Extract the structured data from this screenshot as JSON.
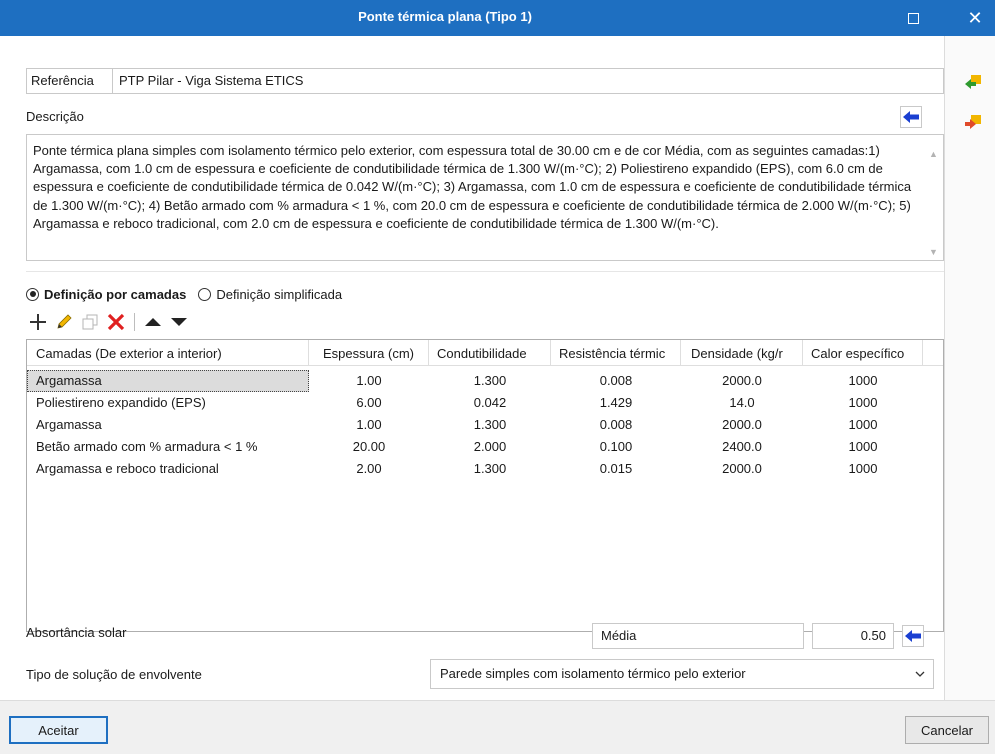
{
  "window": {
    "title": "Ponte térmica plana (Tipo 1)"
  },
  "referencia": {
    "label": "Referência",
    "value": "PTP Pilar - Viga Sistema ETICS"
  },
  "descricao": {
    "label": "Descrição",
    "text": "Ponte térmica plana simples com isolamento térmico pelo exterior, com espessura total de 30.00 cm e de cor Média, com as seguintes camadas:1) Argamassa, com 1.0 cm de espessura e coeficiente de condutibilidade térmica de 1.300 W/(m·°C); 2) Poliestireno expandido (EPS), com 6.0 cm de espessura e coeficiente de condutibilidade térmica de 0.042 W/(m·°C); 3) Argamassa, com 1.0 cm de espessura e coeficiente de condutibilidade térmica de 1.300 W/(m·°C); 4) Betão armado com % armadura < 1 %, com 20.0 cm de espessura e coeficiente de condutibilidade térmica de 2.000 W/(m·°C); 5) Argamassa e reboco tradicional, com 2.0 cm de espessura e coeficiente de condutibilidade térmica de 1.300 W/(m·°C)."
  },
  "mode": {
    "option1": "Definição por camadas",
    "option2": "Definição simplificada",
    "selected": "option1"
  },
  "toolbar": {
    "icons": [
      "plus-icon",
      "pencil-icon",
      "copy-icon",
      "delete-icon",
      "move-up-icon",
      "move-down-icon"
    ]
  },
  "table": {
    "columns": [
      "Camadas (De exterior a interior)",
      "Espessura (cm)",
      "Condutibilidade",
      "Resistência térmic",
      "Densidade (kg/r",
      "Calor específico"
    ],
    "rows": [
      [
        "Argamassa",
        "1.00",
        "1.300",
        "0.008",
        "2000.0",
        "1000"
      ],
      [
        "Poliestireno expandido (EPS)",
        "6.00",
        "0.042",
        "1.429",
        "14.0",
        "1000"
      ],
      [
        "Argamassa",
        "1.00",
        "1.300",
        "0.008",
        "2000.0",
        "1000"
      ],
      [
        "Betão armado com % armadura < 1 %",
        "20.00",
        "2.000",
        "0.100",
        "2400.0",
        "1000"
      ],
      [
        "Argamassa e reboco tradicional",
        "2.00",
        "1.300",
        "0.015",
        "2000.0",
        "1000"
      ]
    ],
    "selected_row": 0
  },
  "absortancia": {
    "label": "Absortância solar",
    "color_value": "Média",
    "numeric_value": "0.50"
  },
  "tipo": {
    "label": "Tipo de solução de envolvente",
    "value": "Parede simples com isolamento térmico pelo exterior"
  },
  "buttons": {
    "accept": "Aceitar",
    "cancel": "Cancelar"
  },
  "colors": {
    "titlebar": "#1e6fc1",
    "accent_blue": "#1a3fd1",
    "delete_red": "#e02020"
  }
}
